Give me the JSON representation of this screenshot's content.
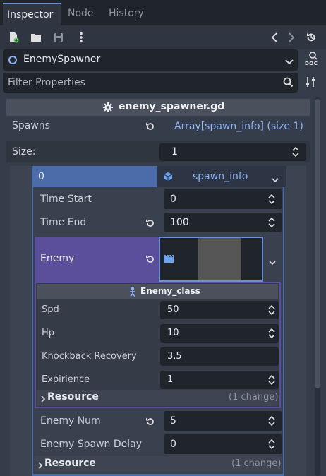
{
  "tabs": [
    {
      "label": "Inspector"
    },
    {
      "label": "Node"
    },
    {
      "label": "History"
    }
  ],
  "node_selector": {
    "name": "EnemySpawner",
    "doc_label": "DOC"
  },
  "filter": {
    "placeholder": "Filter Properties"
  },
  "script_header": {
    "title": "enemy_spawner.gd"
  },
  "spawns": {
    "label": "Spawns",
    "value": "Array[spawn_info] (size 1)"
  },
  "size": {
    "label": "Size:",
    "value": "1"
  },
  "element": {
    "index": "0",
    "type": "spawn_info"
  },
  "spawn_info_props": {
    "time_start": {
      "label": "Time Start",
      "value": "0"
    },
    "time_end": {
      "label": "Time End",
      "value": "100"
    },
    "enemy": {
      "label": "Enemy"
    },
    "enemy_num": {
      "label": "Enemy Num",
      "value": "5"
    },
    "enemy_spawn_delay": {
      "label": "Enemy Spawn Delay",
      "value": "0"
    }
  },
  "enemy_class": {
    "title": "Enemy_class",
    "props": {
      "spd": {
        "label": "Spd",
        "value": "50"
      },
      "hp": {
        "label": "Hp",
        "value": "10"
      },
      "knockback": {
        "label": "Knockback Recovery",
        "value": "3.5"
      },
      "expirience": {
        "label": "Expirience",
        "value": "1"
      }
    },
    "resource": {
      "label": "Resource",
      "changes": "(1 change)"
    }
  },
  "outer_resource": {
    "label": "Resource",
    "changes": "(1 change)"
  },
  "colors": {
    "accent_purple": "#5b4f9c",
    "field_bg": "#20242b",
    "panel_bg": "#363d4a",
    "link_blue": "#8fb3f5"
  }
}
